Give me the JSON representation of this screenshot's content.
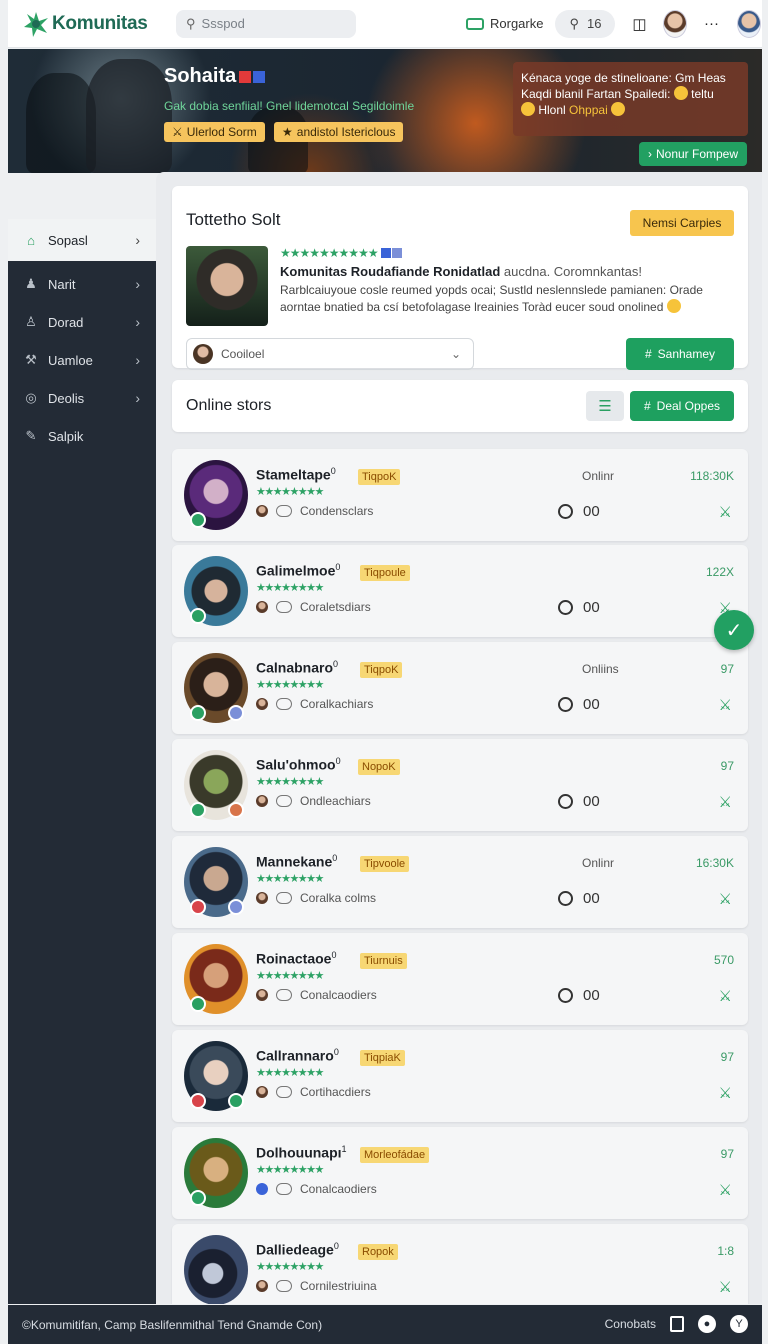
{
  "app": {
    "name": "Komunitas",
    "colors": {
      "brand": "#1f6a55",
      "accent": "#1ea05f",
      "sidebar": "#232b36",
      "badge": "#f7c54e"
    }
  },
  "topbar": {
    "search_placeholder": "Ssspod",
    "gaming_label": "Rorgarke",
    "pill_count": "16"
  },
  "hero": {
    "title": "Sohaita",
    "subtitle": "Gak dobia senfiial! Gnel lidemotcal Segildoimle",
    "chips": [
      "Ulerlod Sorm",
      "andistol Istericlous"
    ],
    "notice_line1": "Kénaca yoge de stinelioane: Gm Heas",
    "notice_line2": "Kaqdi blanil Fartan Spailedi:",
    "notice_tail": "teltu",
    "notice_line3": "Hlonl",
    "notice_highlight": "Ohppai",
    "button_label": "Nonur Fompew"
  },
  "sidebar": {
    "items": [
      {
        "label": "Sopasl",
        "icon": "home-icon"
      },
      {
        "label": "Narit",
        "icon": "user-icon"
      },
      {
        "label": "Dorad",
        "icon": "person-icon"
      },
      {
        "label": "Uamloe",
        "icon": "tools-icon"
      },
      {
        "label": "Deolis",
        "icon": "target-icon"
      },
      {
        "label": "Salpik",
        "icon": "edit-icon"
      }
    ]
  },
  "featured": {
    "title": "Tottetho Solt",
    "badge": "Nemsi Carpies",
    "name": "Komunitas Roudafiande Ronidatlad",
    "name_desc": "aucdna. Coromnkantas!",
    "text": "Rarblcaiuyoue cosle reumed yopds ocai; Sustld neslennslede pamianen: Orade aorntae bnatied ba csí betofolagase lreainies Toràd eucer soud onolined",
    "select_value": "Cooiloel",
    "button_label": "Sanhamey"
  },
  "online": {
    "title": "Online stors",
    "button_label": "Deal Oppes",
    "rows": [
      {
        "name": "Stameltape",
        "tag": "TiqpoK",
        "clan": "Condensclars",
        "status": "Onlinr",
        "count": "118:30K",
        "value": "00"
      },
      {
        "name": "Galimelmoe",
        "tag": "Tiqpoule",
        "clan": "Coraletsdiars",
        "status": "",
        "count": "122X",
        "value": "00"
      },
      {
        "name": "Calnabnaro",
        "tag": "TiqpoK",
        "clan": "Coralkachiars",
        "status": "Onliins",
        "count": "97",
        "value": "00"
      },
      {
        "name": "Salu'ohmoo",
        "tag": "NopoK",
        "clan": "Ondleachiars",
        "status": "",
        "count": "97",
        "value": "00"
      },
      {
        "name": "Mannekane",
        "tag": "Tipvoole",
        "clan": "Coralka colms",
        "status": "Onlinr",
        "count": "16:30K",
        "value": "00"
      },
      {
        "name": "Roinactaoe",
        "tag": "Tiurnuis",
        "clan": "Conalcaodiers",
        "status": "",
        "count": "570",
        "value": "00"
      },
      {
        "name": "Callrannaro",
        "tag": "TiqpiaK",
        "clan": "Cortihacdiers",
        "status": "",
        "count": "97",
        "value": ""
      },
      {
        "name": "Dolhouunapı",
        "tag": "Morleofádae",
        "clan": "Conalcaodiers",
        "status": "",
        "count": "97",
        "value": ""
      },
      {
        "name": "Dalliedeage",
        "tag": "Ropok",
        "clan": "Cornilestriuina",
        "status": "",
        "count": "1:8",
        "value": ""
      }
    ]
  },
  "footer": {
    "copyright": "©Komumitifan, Camp Baslifenmithal Tend Gnamde Con)",
    "right_label": "Conobats"
  }
}
